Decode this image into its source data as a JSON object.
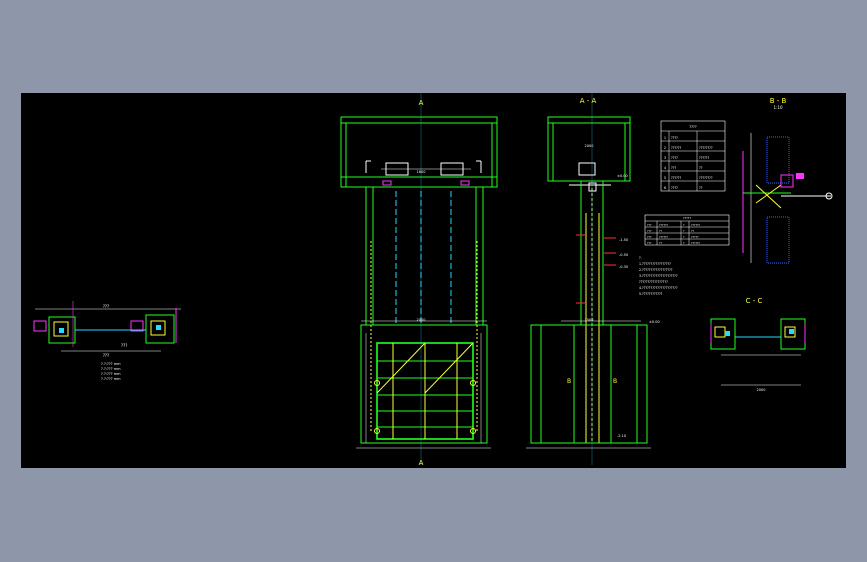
{
  "colors": {
    "background": "#8e97aa",
    "viewport": "#000000",
    "structure": "#22ff22",
    "steel": "#ffff33",
    "dimension": "#ffffff",
    "detail": "#ff33ff",
    "cut": "#22ddff",
    "hatch": "#3366ff",
    "red": "#ff3333"
  },
  "views": {
    "elevation_top": "A",
    "elevation_bottom": "A",
    "section_aa": "A - A",
    "section_bb": "B - B",
    "section_bb_sub": "1:10",
    "section_cc": "C - C",
    "cut_b_left": "B",
    "cut_b_right": "B"
  },
  "dims": {
    "d1": "2000",
    "d2": "1600",
    "d3": "2000",
    "d4": "1500",
    "d5": "1600",
    "d6": "±0.00",
    "d7": "-1.50",
    "d8": "-0.50",
    "d9": "-0.30",
    "d10": "±0.00",
    "d11": "-2.10",
    "d12": "2000"
  },
  "left_detail": {
    "dim_top": "???",
    "dim_bottom": "???",
    "note_title": "???",
    "notes": [
      "?.?:??? mm",
      "?.?:??? mm",
      "?.?:??? mm",
      "?.?:??? mm"
    ]
  },
  "table_top": {
    "header": "????",
    "rows": [
      [
        "1",
        "????",
        ""
      ],
      [
        "2",
        "??????",
        "????????"
      ],
      [
        "3",
        "????",
        "??????"
      ],
      [
        "4",
        "???",
        "??"
      ],
      [
        "5",
        "??????",
        "????????"
      ],
      [
        "6",
        "????",
        "??"
      ]
    ]
  },
  "table_mid": {
    "header": "?????",
    "rows": [
      [
        "???",
        "??????",
        "?",
        "??????"
      ],
      [
        "???",
        "??",
        "?",
        "??"
      ],
      [
        "???",
        "??????",
        "?",
        "?????"
      ],
      [
        "???",
        "??",
        "?",
        "??????"
      ]
    ]
  },
  "notes": [
    "?.",
    "1.?????????????????",
    "2.??????????????????",
    "3.?????????????????????",
    "  ?????????????????",
    "4.?????????????????????",
    "5.????????????"
  ]
}
